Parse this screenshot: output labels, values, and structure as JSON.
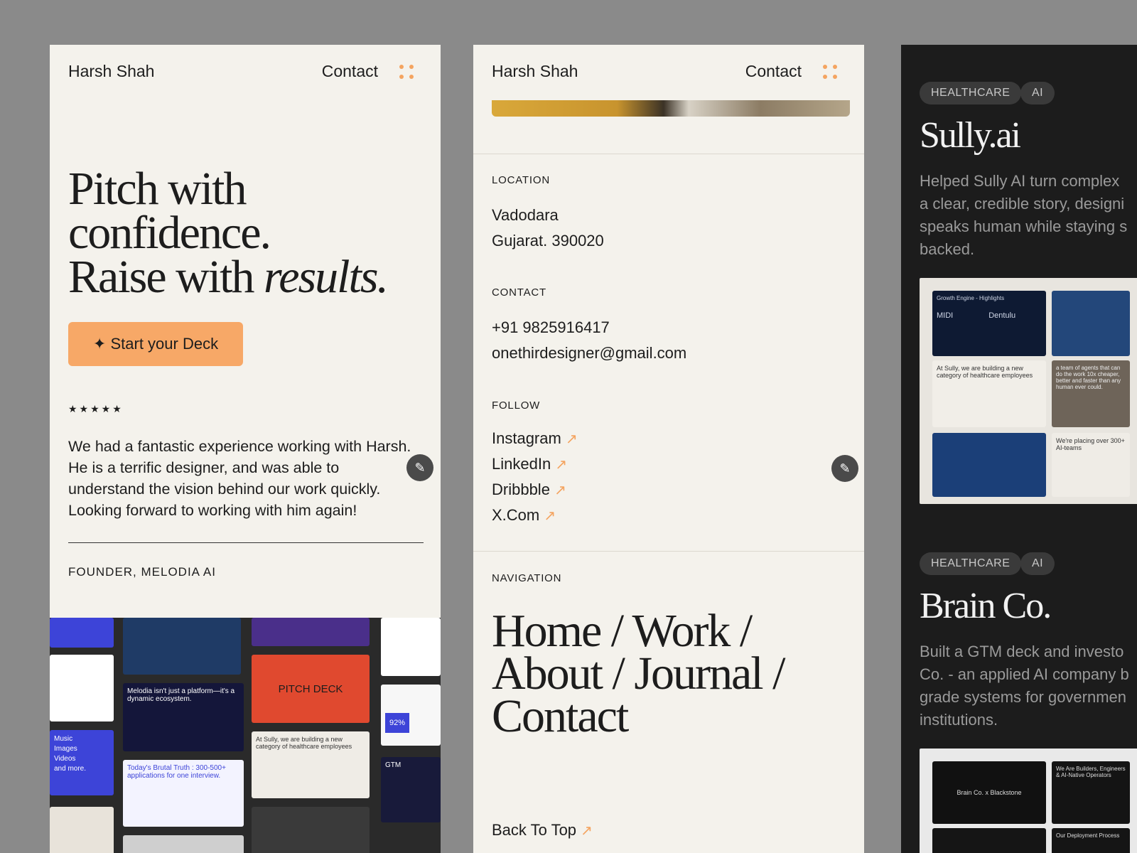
{
  "brand": "Harsh Shah",
  "nav_contact": "Contact",
  "panel1": {
    "hero_line1": "Pitch with",
    "hero_line2": "confidence.",
    "hero_line3a": "Raise with ",
    "hero_line3b": "results.",
    "cta": "✦ Start your Deck",
    "stars": "★★★★★",
    "quote": "We had a fantastic experience working with Harsh. He is a terrific designer, and was able to understand the vision behind our work quickly. Looking forward to working with him again!",
    "author": "FOUNDER, MELODIA AI",
    "gallery": {
      "ecosystem": "Melodia isn't just a platform—it's a dynamic ecosystem.",
      "pitch_deck": "PITCH DECK",
      "music": "Music",
      "images": "Images",
      "videos": "Videos",
      "more": "and more.",
      "brutal": "Today's Brutal Truth : 300-500+ applications for one interview.",
      "sully_small": "At Sully, we are building a new category of healthcare employees",
      "percent": "92%",
      "gtm": "GTM"
    }
  },
  "panel2": {
    "location_label": "LOCATION",
    "city": "Vadodara",
    "state": "Gujarat. 390020",
    "contact_label": "CONTACT",
    "phone": "+91 9825916417",
    "email": "onethirdesigner@gmail.com",
    "follow_label": "FOLLOW",
    "social": [
      "Instagram",
      "LinkedIn",
      "Dribbble",
      "X.Com"
    ],
    "arrow": "↗",
    "navigation_label": "NAVIGATION",
    "nav_line1": "Home / Work /",
    "nav_line2": "About / Journal /",
    "nav_line3": "Contact",
    "back_top": "Back To Top"
  },
  "panel3": {
    "case1": {
      "tags": [
        "HEALTHCARE",
        "AI"
      ],
      "title": "Sully.ai",
      "desc": [
        "Helped Sully AI turn complex",
        "a clear, credible story, designi",
        "speaks human while staying s",
        "backed."
      ],
      "slides": {
        "growth": "Growth Engine - Highlights",
        "midi": "MIDI",
        "dentulu": "Dentulu",
        "sully_new": "At Sully, we are building a new category of healthcare employees",
        "team": "a team of agents that can do the work 10x cheaper, better and faster than any human ever could.",
        "placing": "We're placing over 300+ AI-teams"
      }
    },
    "case2": {
      "tags": [
        "HEALTHCARE",
        "AI"
      ],
      "title": "Brain Co.",
      "desc": [
        "Built a GTM deck and investo",
        "Co. - an applied AI company b",
        "grade systems for governmen",
        "institutions."
      ],
      "slides": {
        "blackstone": "Brain Co. x Blackstone",
        "builders": "We Are Builders, Engineers & AI-Native Operators",
        "deployment": "Our Deployment Process"
      }
    }
  },
  "colors": {
    "accent": "#f4a460",
    "light_bg": "#f4f2ec",
    "dark_bg": "#1c1c1c"
  }
}
